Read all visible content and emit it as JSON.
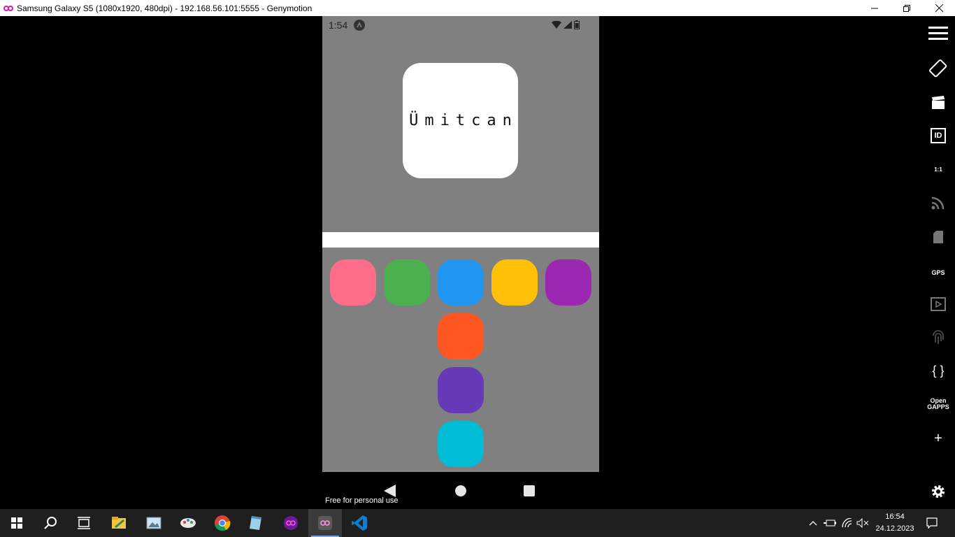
{
  "window": {
    "title": "Samsung Galaxy S5 (1080x1920, 480dpi) - 192.168.56.101:5555 - Genymotion",
    "controls": [
      "minimize-icon",
      "restore-icon",
      "close-icon"
    ]
  },
  "phone": {
    "status_time": "1:54",
    "name_card": "Ümitcan",
    "tiles": [
      {
        "color": "#ff6d8a"
      },
      {
        "color": "#4caf50"
      },
      {
        "color": "#2196f3"
      },
      {
        "color": "#ffc107"
      },
      {
        "color": "#9c27b0"
      },
      {
        "color": "#ff5722"
      },
      {
        "color": "#673ab7"
      },
      {
        "color": "#00bcd4"
      }
    ],
    "background": "#808080"
  },
  "watermark": "Free for personal use",
  "toolbar": {
    "items": [
      {
        "icon": "menu-icon"
      },
      {
        "icon": "rotate-icon"
      },
      {
        "icon": "capture-icon"
      },
      {
        "icon": "id-icon",
        "label": "ID"
      },
      {
        "icon": "pixel-perfect-icon",
        "label": "1:1"
      },
      {
        "icon": "network-icon"
      },
      {
        "icon": "sd-card-icon"
      },
      {
        "icon": "gps-icon",
        "label": "GPS"
      },
      {
        "icon": "media-icon"
      },
      {
        "icon": "fingerprint-icon"
      },
      {
        "icon": "code-icon",
        "label": "{ }"
      },
      {
        "icon": "open-gapps-icon",
        "label": "Open\nGAPPS"
      },
      {
        "icon": "add-icon",
        "label": "+"
      },
      {
        "icon": "settings-icon"
      }
    ]
  },
  "taskbar": {
    "apps": [
      "windows-start-icon",
      "search-icon",
      "task-view-icon",
      "file-explorer-icon",
      "photos-icon",
      "paint-icon",
      "chrome-icon",
      "notepad-icon",
      "genymotion-icon",
      "genymotion-active-icon",
      "vscode-icon"
    ],
    "time": "16:54",
    "date": "24.12.2023"
  }
}
